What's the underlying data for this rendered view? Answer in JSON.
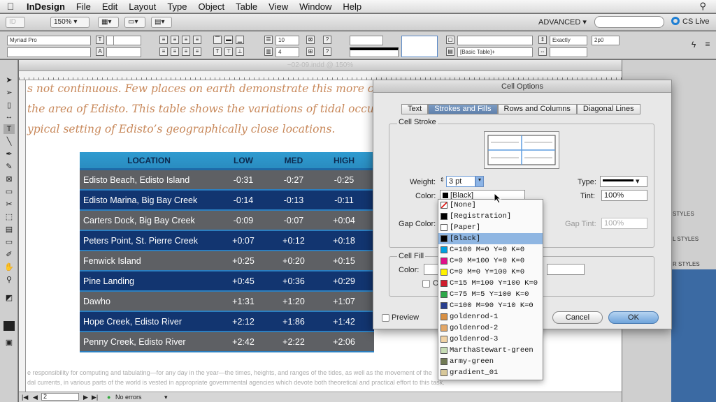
{
  "menubar": {
    "app": "InDesign",
    "menus": [
      "File",
      "Edit",
      "Layout",
      "Type",
      "Object",
      "Table",
      "View",
      "Window",
      "Help"
    ]
  },
  "appbar": {
    "zoom": "150%",
    "workspace": "ADVANCED ▾",
    "cs_live": "CS Live"
  },
  "control": {
    "font": "Myriad Pro",
    "rows_value": "10",
    "cols_value": "4",
    "table_style": "[Basic Table]+",
    "row_height_mode": "Exactly",
    "row_height_value": "2p0"
  },
  "document": {
    "title": "~02-09.indd @ 150%",
    "lines": [
      "s not continuous. Few places on earth demonstrate this more clea",
      "the area of Edisto. This table shows the variations of tidal occurre",
      "ypical setting of Edisto’s geographically close locations."
    ],
    "footer_lines": [
      "e responsibility for computing and tabulating—for any day in the year—the times, heights, and ranges of the tides, as well as the movement of the",
      "dal currents, in various parts of the world is vested in appropriate governmental agencies which devote both theoretical and practical effort to this task."
    ],
    "status": {
      "page": "2",
      "errors": "No errors"
    }
  },
  "table": {
    "headers": [
      "LOCATION",
      "LOW",
      "MED",
      "HIGH"
    ],
    "rows": [
      [
        "Edisto Beach, Edisto Island",
        "-0:31",
        "-0:27",
        "-0:25"
      ],
      [
        "Edisto Marina, Big Bay Creek",
        "-0:14",
        "-0:13",
        "-0:11"
      ],
      [
        "Carters Dock, Big Bay Creek",
        "-0:09",
        "-0:07",
        "+0:04"
      ],
      [
        "Peters Point, St. Pierre Creek",
        "+0:07",
        "+0:12",
        "+0:18"
      ],
      [
        "Fenwick Island",
        "+0:25",
        "+0:20",
        "+0:15"
      ],
      [
        "Pine Landing",
        "+0:45",
        "+0:36",
        "+0:29"
      ],
      [
        "Dawho",
        "+1:31",
        "+1:20",
        "+1:07"
      ],
      [
        "Hope Creek, Edisto River",
        "+2:12",
        "+1:86",
        "+1:42"
      ],
      [
        "Penny Creek, Edisto River",
        "+2:42",
        "+2:22",
        "+2:06"
      ]
    ]
  },
  "rpanel": {
    "label1": "STYLES",
    "label2": "L STYLES",
    "label3": "R STYLES"
  },
  "dialog": {
    "title": "Cell Options",
    "tabs": [
      "Text",
      "Strokes and Fills",
      "Rows and Columns",
      "Diagonal Lines"
    ],
    "cell_stroke_label": "Cell Stroke",
    "weight_label": "Weight:",
    "weight_value": "3 pt",
    "type_label": "Type:",
    "color_label": "Color:",
    "color_value": "[Black]",
    "tint_label": "Tint:",
    "tint_value": "100%",
    "gap_color_label": "Gap Color:",
    "gap_tint_label": "Gap Tint:",
    "gap_tint_value": "100%",
    "cell_fill_label": "Cell Fill",
    "fill_color_label": "Color:",
    "overprint_partial": "Ov",
    "preview_label": "Preview",
    "cancel_label": "Cancel",
    "ok_label": "OK"
  },
  "swatches": [
    {
      "name": "[None]",
      "color": "#ffffff",
      "none": true
    },
    {
      "name": "[Registration]",
      "color": "#000000"
    },
    {
      "name": "[Paper]",
      "color": "#ffffff"
    },
    {
      "name": "[Black]",
      "color": "#000000",
      "selected": true
    },
    {
      "name": "C=100 M=0 Y=0 K=0",
      "color": "#00a0e0"
    },
    {
      "name": "C=0 M=100 Y=0 K=0",
      "color": "#e0108a"
    },
    {
      "name": "C=0 M=0 Y=100 K=0",
      "color": "#fff200"
    },
    {
      "name": "C=15 M=100 Y=100 K=0",
      "color": "#d01c2c"
    },
    {
      "name": "C=75 M=5 Y=100 K=0",
      "color": "#2ea84a"
    },
    {
      "name": "C=100 M=90 Y=10 K=0",
      "color": "#283e8e"
    },
    {
      "name": "goldenrod-1",
      "color": "#d89044"
    },
    {
      "name": "goldenrod-2",
      "color": "#e4a868"
    },
    {
      "name": "goldenrod-3",
      "color": "#f0d2a4"
    },
    {
      "name": "MarthaStewart-green",
      "color": "#c6dcb4"
    },
    {
      "name": "army-green",
      "color": "#707a54"
    },
    {
      "name": "gradient_01",
      "color": "#d8c89a"
    }
  ]
}
